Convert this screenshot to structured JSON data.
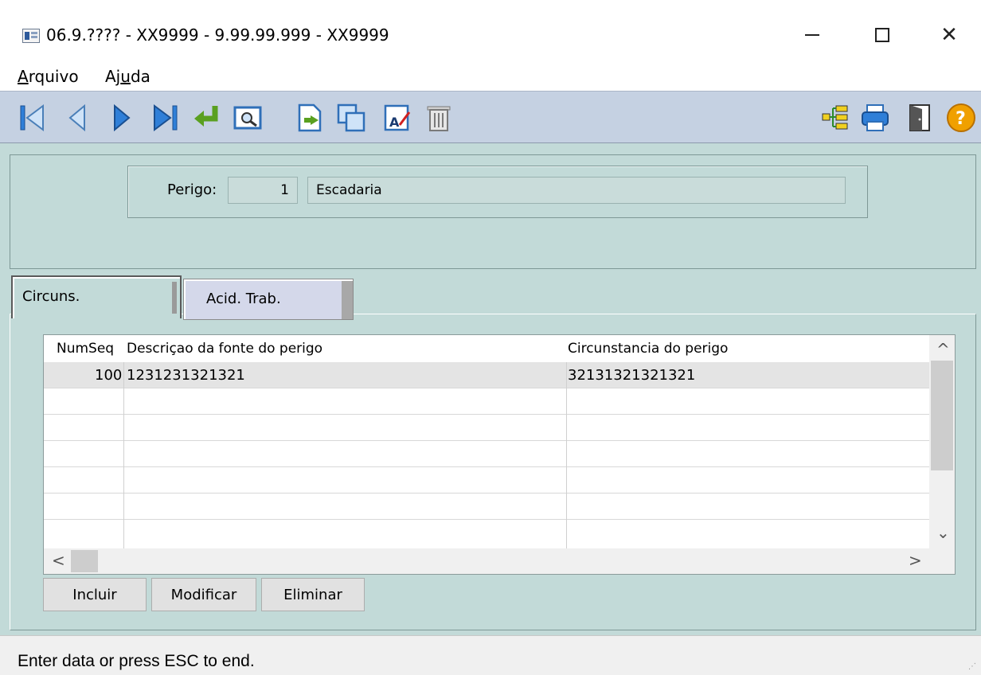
{
  "window": {
    "title": "06.9.???? - XX9999 - 9.99.99.999 - XX9999",
    "minimize": "—",
    "close": "✕"
  },
  "menu": {
    "items": [
      {
        "label": "Arquivo",
        "underline": "A",
        "rest": "rquivo"
      },
      {
        "label": "Ajuda",
        "pre": "Aj",
        "underline": "u",
        "rest": "da"
      }
    ]
  },
  "toolbar": {
    "icons": [
      "first-record-icon",
      "previous-record-icon",
      "next-record-icon",
      "last-record-icon",
      "enter-icon",
      "preview-icon",
      "new-document-icon",
      "copy-icon",
      "edit-icon",
      "delete-icon",
      "tree-icon",
      "print-icon",
      "exit-door-icon",
      "help-icon"
    ]
  },
  "form": {
    "perigo_label": "Perigo:",
    "perigo_number": "1",
    "perigo_description": "Escadaria"
  },
  "tabs": [
    {
      "label": "Circuns.",
      "active": true
    },
    {
      "label": "Acid. Trab.",
      "active": false
    }
  ],
  "grid": {
    "columns": [
      "NumSeq",
      "Descriçao da fonte do perigo",
      "Circunstancia do perigo"
    ],
    "rows": [
      {
        "numseq": "100",
        "descricao": "1231231321321",
        "circunstancia": "32131321321321"
      }
    ],
    "scroll_up": "^",
    "scroll_down": "⌄",
    "scroll_left": "<",
    "scroll_right": ">"
  },
  "buttons": {
    "incluir": "Incluir",
    "modificar": "Modificar",
    "eliminar": "Eliminar"
  },
  "status": {
    "text": "Enter data or press ESC to end."
  },
  "colors": {
    "toolbar": "#c5d1e2",
    "panel": "#c2dad8",
    "nav_blue": "#2f7fd8",
    "enter_green": "#5aa020",
    "help_orange": "#f0a000"
  }
}
